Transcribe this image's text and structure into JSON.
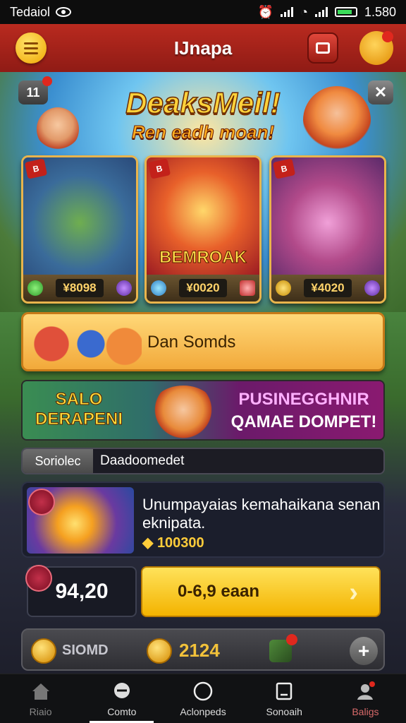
{
  "statusbar": {
    "carrier": "Tedaiol",
    "time": "1.580"
  },
  "appbar": {
    "title": "IJnapa"
  },
  "hero": {
    "level": "11",
    "title": "DeaksMeil!",
    "subtitle": "Ren eadh moan!",
    "cards": [
      {
        "tag": "B",
        "label": "",
        "price": "¥8098"
      },
      {
        "tag": "B",
        "label": "BEMROAK",
        "price": "¥0020"
      },
      {
        "tag": "B",
        "label": "",
        "price": "¥4020"
      }
    ]
  },
  "promo": {
    "label": "Dan Somds"
  },
  "banner": {
    "left_line1": "SALO",
    "left_line2": "DERAPENI",
    "right_line1": "PUSINEGGHNIR",
    "right_line2": "QAMAE DOMPET!"
  },
  "search": {
    "label": "Soriolec",
    "value": "Daadoomedet"
  },
  "offer": {
    "text": "Unumpayaias kemahaikana senan eknipata.",
    "coins": "100300"
  },
  "purchase": {
    "value": "94,20",
    "buy_label": "0-6,9 eaan"
  },
  "stats": {
    "label": "SIOMD",
    "coins": "2124"
  },
  "nav": [
    {
      "label": "Riaio",
      "state": "dim"
    },
    {
      "label": "Comto",
      "state": "normal"
    },
    {
      "label": "Aclonpeds",
      "state": "normal"
    },
    {
      "label": "Sonoaih",
      "state": "normal"
    },
    {
      "label": "Baligs",
      "state": "alert"
    }
  ],
  "colors": {
    "appbar": "#b92a1f",
    "accent_gold": "#f3b300",
    "nav_bg": "#111214"
  }
}
